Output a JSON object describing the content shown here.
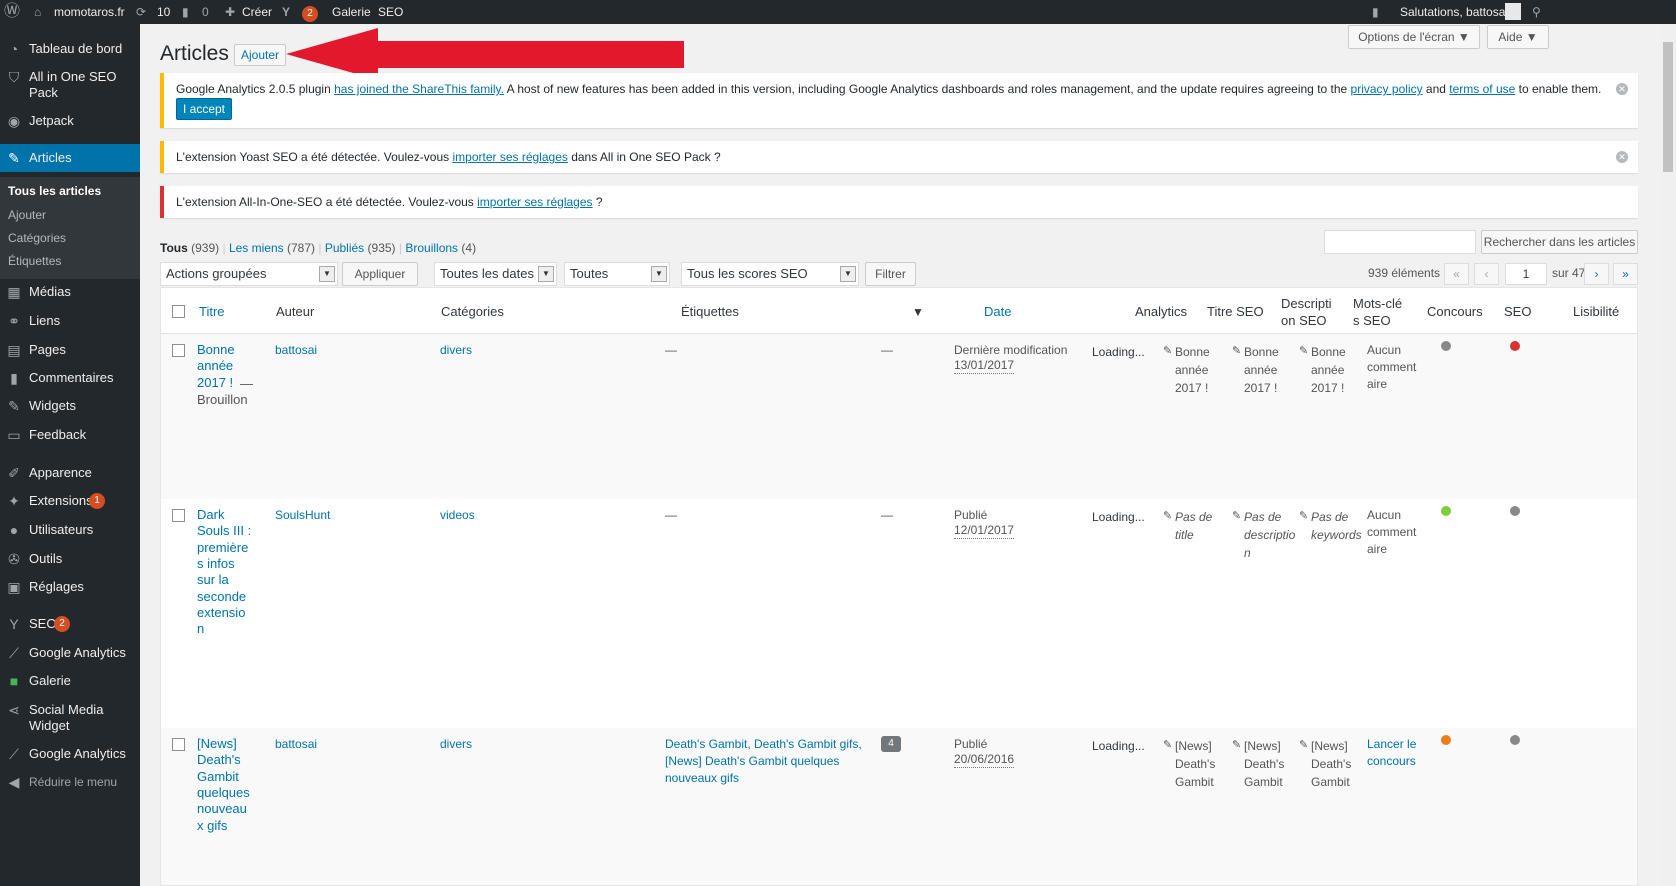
{
  "adminbar": {
    "site": "momotaros.fr",
    "updates": "10",
    "comments": "0",
    "create": "Créer",
    "yoast_count": "2",
    "gallery": "Galerie",
    "seo": "SEO",
    "greeting": "Salutations, battosai"
  },
  "sidebar": {
    "items": [
      {
        "label": "Tableau de bord",
        "icon": "dashboard-icon"
      },
      {
        "label": "All in One SEO Pack",
        "icon": "shield-icon"
      },
      {
        "label": "Jetpack",
        "icon": "jetpack-icon"
      },
      {
        "label": "Articles",
        "icon": "pin-icon"
      },
      {
        "label": "Médias",
        "icon": "media-icon"
      },
      {
        "label": "Liens",
        "icon": "link-icon"
      },
      {
        "label": "Pages",
        "icon": "page-icon"
      },
      {
        "label": "Commentaires",
        "icon": "comment-icon"
      },
      {
        "label": "Widgets",
        "icon": "widget-icon"
      },
      {
        "label": "Feedback",
        "icon": "feedback-icon"
      },
      {
        "label": "Apparence",
        "icon": "brush-icon"
      },
      {
        "label": "Extensions",
        "icon": "plugin-icon",
        "badge": "1"
      },
      {
        "label": "Utilisateurs",
        "icon": "users-icon"
      },
      {
        "label": "Outils",
        "icon": "tools-icon"
      },
      {
        "label": "Réglages",
        "icon": "settings-icon"
      },
      {
        "label": "SEO",
        "icon": "yoast-icon",
        "badge": "2"
      },
      {
        "label": "Google Analytics",
        "icon": "analytics-icon"
      },
      {
        "label": "Galerie",
        "icon": "gallery-icon"
      },
      {
        "label": "Social Media Widget",
        "icon": "share-icon"
      },
      {
        "label": "Google Analytics",
        "icon": "analytics-icon"
      },
      {
        "label": "Réduire le menu",
        "icon": "collapse-icon"
      }
    ],
    "submenu": [
      "Tous les articles",
      "Ajouter",
      "Catégories",
      "Étiquettes"
    ]
  },
  "header": {
    "title": "Articles",
    "add_button": "Ajouter",
    "screen_options": "Options de l'écran",
    "help": "Aide"
  },
  "notices": {
    "ga": {
      "t1": "Google Analytics 2.0.5 plugin ",
      "l1": "has joined the ShareThis family.",
      "t2": " A host of new features has been added in this version, including Google Analytics dashboards and roles management, and the update requires agreeing to the ",
      "l2": "privacy policy",
      "t3": " and ",
      "l3": "terms of use",
      "t4": " to enable them.",
      "button": "I accept"
    },
    "yoast": {
      "t1": "L'extension Yoast SEO a été détectée. Voulez-vous ",
      "l1": "importer ses réglages",
      "t2": " dans All in One SEO Pack ?"
    },
    "aioseo": {
      "t1": "L'extension All-In-One-SEO a été détectée. Voulez-vous ",
      "l1": "importer ses réglages",
      "t2": " ?"
    }
  },
  "filters": {
    "views": {
      "all": "Tous",
      "all_count": "(939)",
      "mine": "Les miens",
      "mine_count": "(787)",
      "published": "Publiés",
      "published_count": "(935)",
      "drafts": "Brouillons",
      "drafts_count": "(4)"
    },
    "search_button": "Rechercher dans les articles",
    "bulk": "Actions groupées",
    "apply": "Appliquer",
    "dates": "Toutes les dates",
    "cats": "Toutes",
    "seo_scores": "Tous les scores SEO",
    "filter": "Filtrer",
    "count": "939 éléments",
    "first": "«",
    "prev": "‹",
    "page": "1",
    "of": "sur 47",
    "next": "›",
    "last": "»"
  },
  "table": {
    "headers": {
      "title": "Titre",
      "author": "Auteur",
      "categories": "Catégories",
      "tags": "Étiquettes",
      "date": "Date",
      "analytics": "Analytics",
      "seo_title_1": "Titre SEO",
      "desc_1": "Descripti",
      "desc_2": "on SEO",
      "kw_1": "Mots-clé",
      "kw_2": "s SEO",
      "contest": "Concours",
      "seo": "SEO",
      "readability": "Lisibilité"
    },
    "rows": [
      {
        "title_lines": [
          "Bonne",
          "année",
          "2017 !"
        ],
        "state": "— Brouillon",
        "state_lines": [
          "Brouillon"
        ],
        "author": "battosai",
        "category": "divers",
        "tags": "—",
        "comments": "—",
        "date_status": "Dernière modification",
        "date": "13/01/2017",
        "analytics": "Loading...",
        "seo_title": [
          "Bonne",
          "année",
          "2017 !"
        ],
        "seo_desc": [
          "Bonne",
          "année",
          "2017 !"
        ],
        "seo_kw": [
          "Bonne",
          "année",
          "2017 !"
        ],
        "contest": [
          "Aucun",
          "comment",
          "aire"
        ],
        "seo_color": "#888888",
        "read_color": "#dc3232"
      },
      {
        "title_lines": [
          "Dark",
          "Souls III :",
          "première",
          "s infos",
          "sur la",
          "seconde",
          "extensio",
          "n"
        ],
        "author": "SoulsHunt",
        "category": "videos",
        "tags": "—",
        "comments": "—",
        "date_status": "Publié",
        "date": "12/01/2017",
        "analytics": "Loading...",
        "seo_title": [
          "Pas de",
          "title"
        ],
        "seo_desc": [
          "Pas de",
          "descriptio",
          "n"
        ],
        "seo_kw": [
          "Pas de",
          "keywords"
        ],
        "contest": [
          "Aucun",
          "comment",
          "aire"
        ],
        "seo_color": "#7ad03a",
        "read_color": "#888888"
      },
      {
        "title_lines": [
          "[News]",
          "Death's",
          "Gambit",
          "quelques",
          "nouveau",
          "x gifs"
        ],
        "author": "battosai",
        "category": "divers",
        "tags": [
          "Death's Gambit, Death's Gambit gifs,",
          "[News] Death's Gambit quelques",
          "nouveaux gifs"
        ],
        "comments": "4",
        "date_status": "Publié",
        "date": "20/06/2016",
        "analytics": "Loading...",
        "seo_title": [
          "[News]",
          "Death's",
          "Gambit"
        ],
        "seo_desc": [
          "[News]",
          "Death's",
          "Gambit"
        ],
        "seo_kw": [
          "[News]",
          "Death's",
          "Gambit"
        ],
        "contest": [
          "Lancer le",
          "concours"
        ],
        "seo_color": "#ee7c1b",
        "read_color": "#888888"
      }
    ]
  },
  "colors": {
    "accent": "#0073aa",
    "arrow": "#e3182d"
  }
}
